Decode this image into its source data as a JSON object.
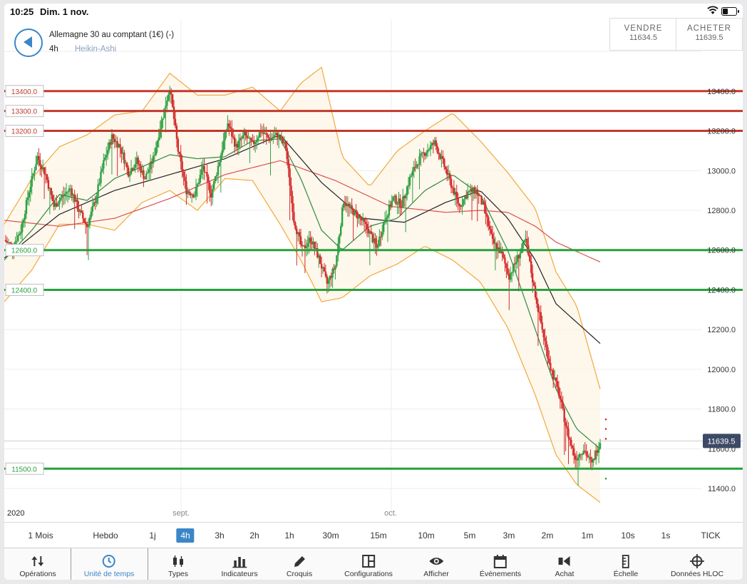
{
  "status_bar": {
    "time": "10:25",
    "date": "Dim. 1 nov."
  },
  "header": {
    "instrument": "Allemagne 30 au comptant (1€) (-)",
    "timeframe": "4h",
    "chart_type": "Heikin-Ashi",
    "sell_label": "VENDRE",
    "sell_price": "11634.5",
    "buy_label": "ACHETER",
    "buy_price": "11639.5"
  },
  "chart_data": {
    "type": "candlestick",
    "price_axis": {
      "min": 11300,
      "max": 13550,
      "ticks": [
        "13400.0",
        "13200.0",
        "13000.0",
        "12800.0",
        "12600.0",
        "12400.0",
        "12200.0",
        "12000.0",
        "11800.0",
        "11600.0",
        "11400.0"
      ]
    },
    "time_labels": [
      {
        "label": "2020",
        "pos": "left"
      },
      {
        "label": "sept.",
        "pos": "sep"
      },
      {
        "label": "oct.",
        "pos": "oct"
      }
    ],
    "current_price": "11639.5",
    "levels": [
      {
        "label": "13400.0",
        "value": 13400,
        "color": "#c0392b"
      },
      {
        "label": "13300.0",
        "value": 13300,
        "color": "#c0392b"
      },
      {
        "label": "13200.0",
        "value": 13200,
        "color": "#c0392b"
      },
      {
        "label": "12600.0",
        "value": 12600,
        "color": "#27a03c"
      },
      {
        "label": "12400.0",
        "value": 12400,
        "color": "#27a03c"
      },
      {
        "label": "11500.0",
        "value": 11500,
        "color": "#27a03c"
      }
    ],
    "close_path": [
      [
        0,
        12650
      ],
      [
        6,
        12620
      ],
      [
        12,
        12700
      ],
      [
        18,
        12900
      ],
      [
        24,
        13070
      ],
      [
        30,
        12980
      ],
      [
        36,
        12820
      ],
      [
        42,
        12870
      ],
      [
        48,
        12910
      ],
      [
        54,
        12800
      ],
      [
        60,
        12720
      ],
      [
        66,
        12850
      ],
      [
        72,
        13040
      ],
      [
        78,
        13170
      ],
      [
        84,
        13120
      ],
      [
        90,
        12990
      ],
      [
        96,
        13050
      ],
      [
        102,
        12960
      ],
      [
        108,
        13060
      ],
      [
        114,
        13250
      ],
      [
        120,
        13420
      ],
      [
        126,
        13100
      ],
      [
        132,
        12900
      ],
      [
        138,
        12880
      ],
      [
        144,
        13020
      ],
      [
        150,
        12880
      ],
      [
        156,
        13050
      ],
      [
        162,
        13240
      ],
      [
        168,
        13120
      ],
      [
        174,
        13180
      ],
      [
        180,
        13130
      ],
      [
        186,
        13200
      ],
      [
        192,
        13160
      ],
      [
        198,
        13180
      ],
      [
        204,
        13120
      ],
      [
        210,
        12750
      ],
      [
        216,
        12600
      ],
      [
        222,
        12660
      ],
      [
        228,
        12560
      ],
      [
        234,
        12430
      ],
      [
        240,
        12520
      ],
      [
        246,
        12850
      ],
      [
        252,
        12800
      ],
      [
        258,
        12760
      ],
      [
        264,
        12700
      ],
      [
        270,
        12610
      ],
      [
        276,
        12760
      ],
      [
        282,
        12860
      ],
      [
        288,
        12830
      ],
      [
        294,
        12960
      ],
      [
        300,
        13050
      ],
      [
        306,
        13100
      ],
      [
        312,
        13140
      ],
      [
        318,
        13040
      ],
      [
        324,
        12930
      ],
      [
        330,
        12820
      ],
      [
        336,
        12890
      ],
      [
        342,
        12900
      ],
      [
        348,
        12810
      ],
      [
        354,
        12640
      ],
      [
        360,
        12590
      ],
      [
        366,
        12470
      ],
      [
        372,
        12560
      ],
      [
        378,
        12650
      ],
      [
        384,
        12410
      ],
      [
        390,
        12200
      ],
      [
        396,
        12010
      ],
      [
        402,
        11880
      ],
      [
        408,
        11690
      ],
      [
        414,
        11550
      ],
      [
        420,
        11600
      ],
      [
        426,
        11520
      ],
      [
        432,
        11640
      ]
    ],
    "bb_upper": [
      [
        0,
        12730
      ],
      [
        20,
        12960
      ],
      [
        40,
        13120
      ],
      [
        60,
        13180
      ],
      [
        80,
        13280
      ],
      [
        100,
        13300
      ],
      [
        120,
        13490
      ],
      [
        140,
        13380
      ],
      [
        160,
        13380
      ],
      [
        180,
        13420
      ],
      [
        200,
        13300
      ],
      [
        215,
        13440
      ],
      [
        230,
        13520
      ],
      [
        245,
        13070
      ],
      [
        265,
        12920
      ],
      [
        285,
        13100
      ],
      [
        305,
        13200
      ],
      [
        325,
        13290
      ],
      [
        345,
        13150
      ],
      [
        365,
        12990
      ],
      [
        385,
        12810
      ],
      [
        400,
        12490
      ],
      [
        415,
        12320
      ],
      [
        432,
        11900
      ]
    ],
    "bb_lower": [
      [
        0,
        12340
      ],
      [
        20,
        12500
      ],
      [
        40,
        12730
      ],
      [
        60,
        12730
      ],
      [
        80,
        12700
      ],
      [
        100,
        12840
      ],
      [
        120,
        12900
      ],
      [
        140,
        12800
      ],
      [
        160,
        12960
      ],
      [
        180,
        12950
      ],
      [
        200,
        12730
      ],
      [
        215,
        12550
      ],
      [
        230,
        12340
      ],
      [
        245,
        12360
      ],
      [
        265,
        12470
      ],
      [
        285,
        12530
      ],
      [
        305,
        12620
      ],
      [
        325,
        12550
      ],
      [
        345,
        12440
      ],
      [
        365,
        12210
      ],
      [
        385,
        11870
      ],
      [
        400,
        11570
      ],
      [
        415,
        11420
      ],
      [
        432,
        11330
      ]
    ],
    "ma_short": [
      [
        0,
        12550
      ],
      [
        20,
        12700
      ],
      [
        40,
        12880
      ],
      [
        60,
        12850
      ],
      [
        80,
        12960
      ],
      [
        100,
        13020
      ],
      [
        120,
        13080
      ],
      [
        140,
        13060
      ],
      [
        160,
        13070
      ],
      [
        180,
        13150
      ],
      [
        200,
        13160
      ],
      [
        215,
        12960
      ],
      [
        230,
        12700
      ],
      [
        245,
        12600
      ],
      [
        265,
        12720
      ],
      [
        285,
        12760
      ],
      [
        305,
        12900
      ],
      [
        325,
        12980
      ],
      [
        345,
        12880
      ],
      [
        365,
        12600
      ],
      [
        385,
        12200
      ],
      [
        400,
        11900
      ],
      [
        415,
        11700
      ],
      [
        432,
        11600
      ]
    ],
    "ma_mid": [
      [
        0,
        12560
      ],
      [
        40,
        12780
      ],
      [
        80,
        12900
      ],
      [
        120,
        12980
      ],
      [
        160,
        13060
      ],
      [
        200,
        13180
      ],
      [
        230,
        12940
      ],
      [
        260,
        12760
      ],
      [
        290,
        12740
      ],
      [
        320,
        12840
      ],
      [
        345,
        12900
      ],
      [
        365,
        12760
      ],
      [
        385,
        12550
      ],
      [
        400,
        12330
      ],
      [
        432,
        12130
      ]
    ],
    "ma_long": [
      [
        0,
        12750
      ],
      [
        40,
        12720
      ],
      [
        80,
        12760
      ],
      [
        120,
        12860
      ],
      [
        160,
        12980
      ],
      [
        200,
        13050
      ],
      [
        240,
        12950
      ],
      [
        280,
        12820
      ],
      [
        320,
        12790
      ],
      [
        345,
        12800
      ],
      [
        365,
        12790
      ],
      [
        385,
        12720
      ],
      [
        400,
        12640
      ],
      [
        432,
        12540
      ]
    ]
  },
  "timeframes": [
    "1 Mois",
    "Hebdo",
    "1j",
    "4h",
    "3h",
    "2h",
    "1h",
    "30m",
    "15m",
    "10m",
    "5m",
    "3m",
    "2m",
    "1m",
    "10s",
    "1s",
    "TICK"
  ],
  "active_timeframe_index": 3,
  "toolbar": [
    {
      "label": "Opérations",
      "icon": "arrows-updown-icon"
    },
    {
      "label": "Unité de temps",
      "icon": "clock-icon"
    },
    {
      "label": "Types",
      "icon": "candles-icon"
    },
    {
      "label": "Indicateurs",
      "icon": "bar-chart-icon"
    },
    {
      "label": "Croquis",
      "icon": "pencil-icon"
    },
    {
      "label": "Configurations",
      "icon": "layout-icon"
    },
    {
      "label": "Afficher",
      "icon": "eye-icon"
    },
    {
      "label": "Événements",
      "icon": "calendar-icon"
    },
    {
      "label": "Achat",
      "icon": "buy-icon"
    },
    {
      "label": "Échelle",
      "icon": "ruler-icon"
    },
    {
      "label": "Données HLOC",
      "icon": "crosshair-icon"
    }
  ],
  "colors": {
    "accent": "#3a86c8",
    "up": "#2ea043",
    "down": "#d42b2b",
    "bands": "#f2a93b"
  }
}
